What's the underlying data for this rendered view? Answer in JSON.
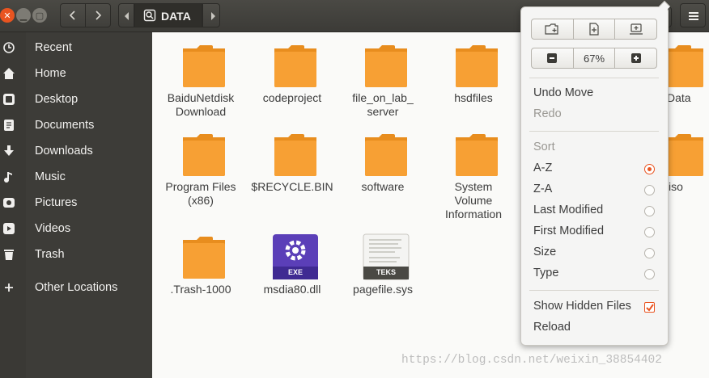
{
  "window": {
    "title": "DATA",
    "icons": [
      "close-icon",
      "minimize-icon",
      "maximize-icon",
      "back-icon",
      "forward-icon",
      "menu-icon"
    ]
  },
  "sidebar": {
    "items": [
      {
        "label": "Recent",
        "icon": "clock-icon"
      },
      {
        "label": "Home",
        "icon": "home-icon"
      },
      {
        "label": "Desktop",
        "icon": "desktop-icon"
      },
      {
        "label": "Documents",
        "icon": "document-icon"
      },
      {
        "label": "Downloads",
        "icon": "download-icon"
      },
      {
        "label": "Music",
        "icon": "music-icon"
      },
      {
        "label": "Pictures",
        "icon": "picture-icon"
      },
      {
        "label": "Videos",
        "icon": "video-icon"
      },
      {
        "label": "Trash",
        "icon": "trash-icon"
      },
      {
        "label": "Other Locations",
        "icon": "plus-icon"
      }
    ]
  },
  "files": [
    {
      "name": "BaiduNetdisk Download",
      "type": "folder"
    },
    {
      "name": "codeproject",
      "type": "folder"
    },
    {
      "name": "file_on_lab_ server",
      "type": "folder"
    },
    {
      "name": "hsdfiles",
      "type": "folder"
    },
    {
      "name": "Data",
      "type": "folder"
    },
    {
      "name": "Program Files (x86)",
      "type": "folder"
    },
    {
      "name": "$RECYCLE.BIN",
      "type": "folder"
    },
    {
      "name": "software",
      "type": "folder"
    },
    {
      "name": "System Volume Information",
      "type": "folder"
    },
    {
      "name": "iso",
      "type": "folder"
    },
    {
      "name": ".Trash-1000",
      "type": "folder"
    },
    {
      "name": "msdia80.dll",
      "type": "exe",
      "badge": "EXE"
    },
    {
      "name": "pagefile.sys",
      "type": "text",
      "badge": "TEKS"
    }
  ],
  "popover": {
    "zoom": "67%",
    "undo": "Undo Move",
    "redo": "Redo",
    "sort_header": "Sort",
    "sort_options": [
      "A-Z",
      "Z-A",
      "Last Modified",
      "First Modified",
      "Size",
      "Type"
    ],
    "sort_selected": "A-Z",
    "show_hidden": "Show Hidden Files",
    "show_hidden_checked": true,
    "reload": "Reload"
  },
  "colors": {
    "accent": "#e95420",
    "folder": "#f7a034",
    "sidebar": "#3d3c38"
  },
  "watermark": "https://blog.csdn.net/weixin_38854402"
}
